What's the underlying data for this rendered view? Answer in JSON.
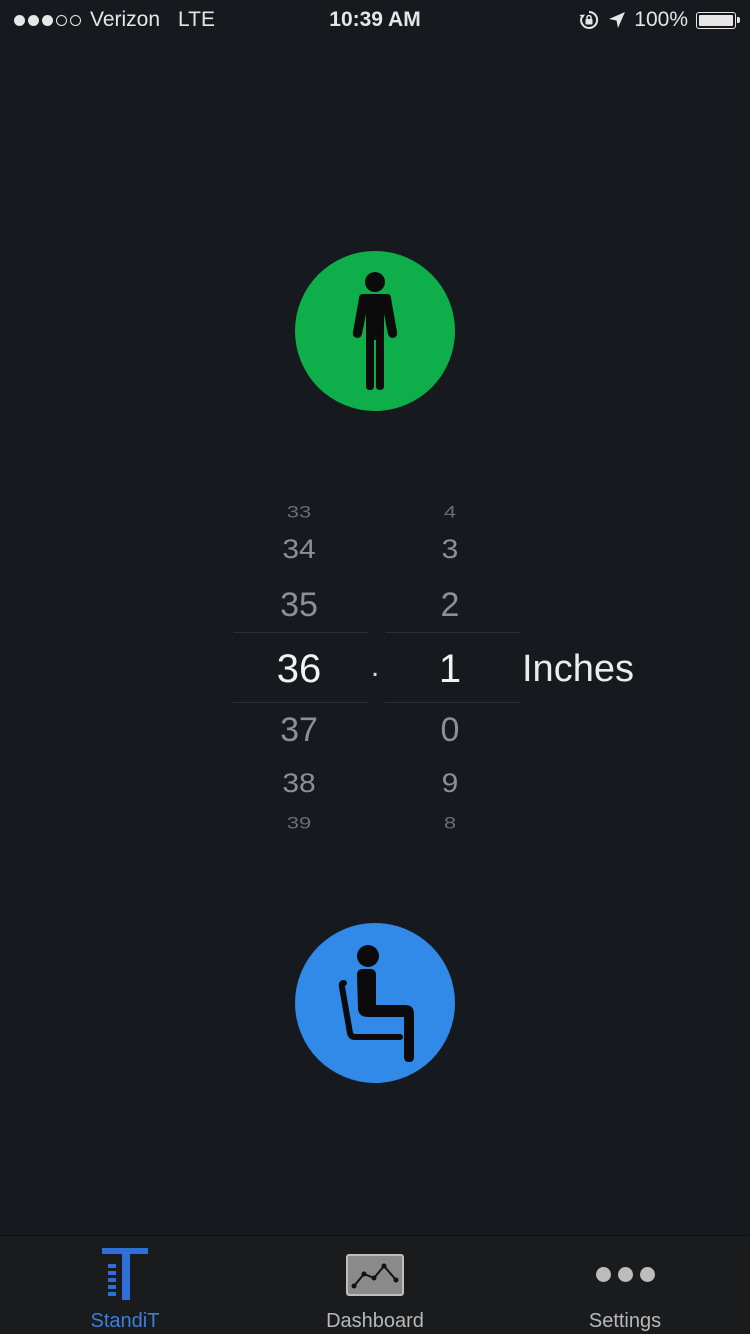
{
  "status_bar": {
    "carrier": "Verizon",
    "network": "LTE",
    "time": "10:39 AM",
    "battery": "100%",
    "signal_bars_filled": 3,
    "signal_bars_total": 5,
    "icons": [
      "orientation-lock-icon",
      "location-arrow-icon",
      "battery-icon"
    ]
  },
  "buttons": {
    "stand": {
      "icon": "standing-person-icon",
      "color": "#0eaf4a"
    },
    "sit": {
      "icon": "sitting-person-icon",
      "color": "#3189e8"
    }
  },
  "picker": {
    "whole": [
      "33",
      "34",
      "35",
      "36",
      "37",
      "38",
      "39"
    ],
    "whole_selected": "36",
    "separator": ".",
    "decimal": [
      "4",
      "3",
      "2",
      "1",
      "0",
      "9",
      "8"
    ],
    "decimal_selected": "1",
    "unit": "Inches"
  },
  "tab_bar": {
    "tabs": [
      {
        "label": "StandiT",
        "icon": "standit-logo-icon",
        "active": true
      },
      {
        "label": "Dashboard",
        "icon": "chart-icon",
        "active": false
      },
      {
        "label": "Settings",
        "icon": "more-dots-icon",
        "active": false
      }
    ],
    "active_color": "#3a7fe0"
  }
}
